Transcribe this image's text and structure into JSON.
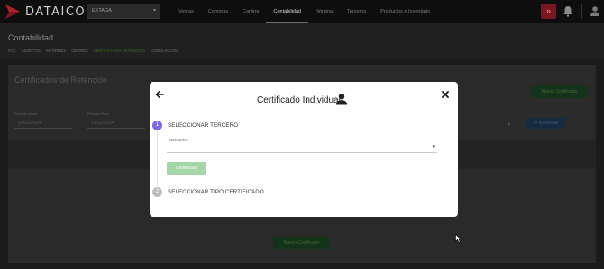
{
  "app": {
    "brand": "DATAICO",
    "company_select": "EKTAGA",
    "nav": [
      "Ventas",
      "Compras",
      "Cartera",
      "Contabilidad",
      "Nómina",
      "Terceros",
      "Productos e Inventario"
    ],
    "nav_active": "Contabilidad",
    "accent_red": "#7a1622"
  },
  "page": {
    "title": "Contabilidad",
    "subnav": [
      "PUC",
      "ASIENTOS",
      "INFORMES",
      "CIERRES",
      "CERTIFICADOS RETENCIÓN",
      "CONCILIACIÓN"
    ],
    "subnav_active": "CERTIFICADOS RETENCIÓN"
  },
  "background": {
    "card_title": "Certificados de Retención",
    "new_certificate_button": "Nuevo Certificado",
    "from_label": "Periodo Inicial",
    "from_value": "01/01/2024",
    "to_label": "Periodo Final",
    "to_value": "31/12/2024",
    "refresh_button": "⟳ Actualizar",
    "empty_button": "Nuevo Certificado"
  },
  "modal": {
    "title": "Certificado Individual",
    "title_icon": "user-icon",
    "steps": [
      {
        "number": "1",
        "label": "SELECCIONAR TERCERO",
        "state": "active"
      },
      {
        "number": "2",
        "label": "SELECCIONAR TIPO CERTIFICADO",
        "state": "inactive"
      }
    ],
    "tercero_label": "TERCERO",
    "tercero_value": "",
    "continue_label": "Continuar",
    "step_color": "#7b68ee",
    "continue_color": "#a5d6a7"
  }
}
